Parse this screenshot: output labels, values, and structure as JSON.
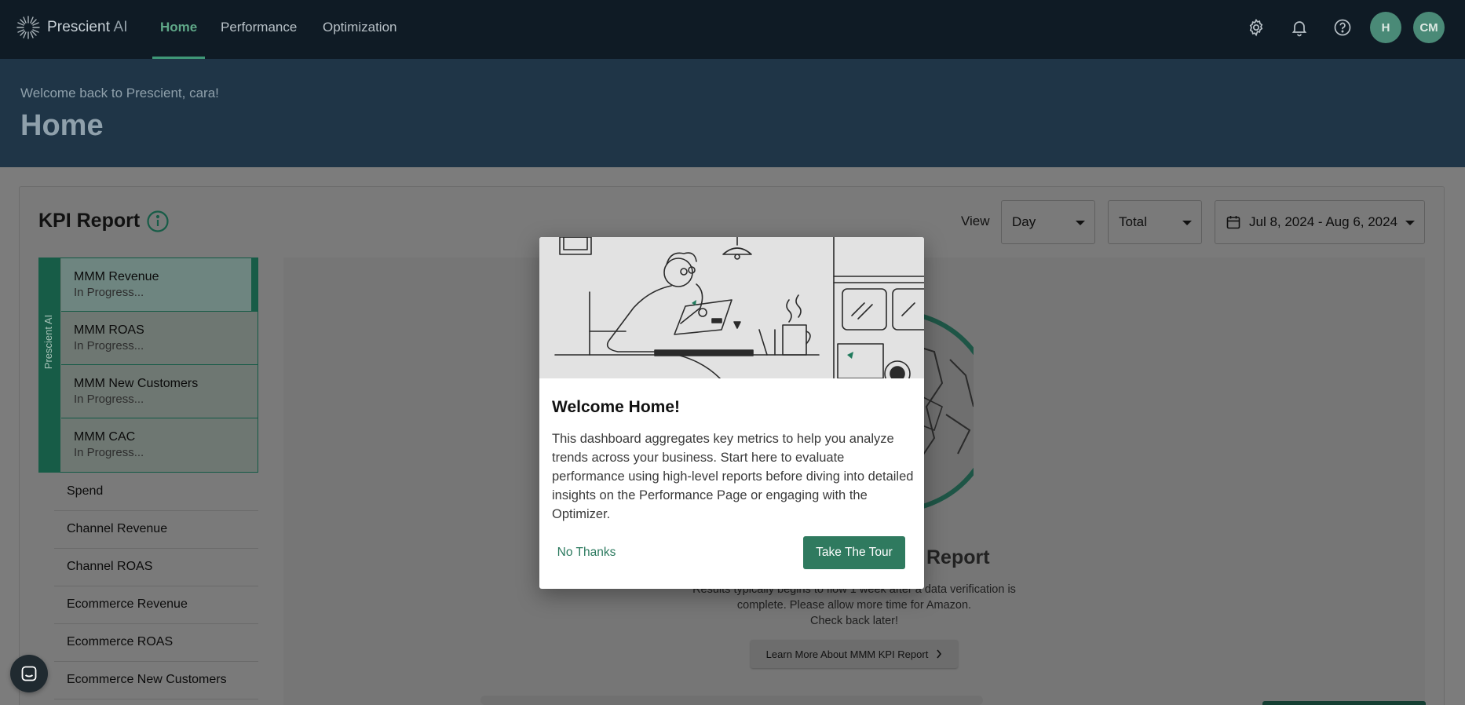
{
  "brand": {
    "name": "Prescient",
    "suffix": "AI"
  },
  "nav": {
    "tabs": [
      "Home",
      "Performance",
      "Optimization"
    ],
    "active": "Home"
  },
  "header_icons": [
    "gear-icon",
    "bell-icon",
    "help-icon"
  ],
  "avatars": [
    "H",
    "CM"
  ],
  "band": {
    "subtitle": "Welcome back to Prescient, cara!",
    "title": "Home"
  },
  "kpi": {
    "title": "KPI Report",
    "view_label": "View",
    "view_select": "Day",
    "agg_select": "Total",
    "date_range": "Jul 8, 2024 - Aug 6, 2024",
    "group_label": "Prescient AI",
    "highlighted": [
      {
        "label": "MMM Revenue",
        "status": "In Progress..."
      },
      {
        "label": "MMM ROAS",
        "status": "In Progress..."
      },
      {
        "label": "MMM New Customers",
        "status": "In Progress..."
      },
      {
        "label": "MMM CAC",
        "status": "In Progress..."
      }
    ],
    "items": [
      "Spend",
      "Channel Revenue",
      "Channel ROAS",
      "Ecommerce Revenue",
      "Ecommerce ROAS",
      "Ecommerce New Customers"
    ]
  },
  "empty_state": {
    "title_visible": "Report",
    "desc_line1": "Results typically begins to flow 1 week after a data verification is",
    "desc_line2": "complete. Please allow more time for Amazon.",
    "desc_line3": "Check back later!",
    "learn_more": "Learn More About MMM KPI Report"
  },
  "modal": {
    "title": "Welcome Home!",
    "body": "This dashboard aggregates key metrics to help you analyze trends across your business. Start here to evaluate performance using high-level reports before diving into detailed insights on the Performance Page or engaging with the Optimizer.",
    "secondary_label": "No Thanks",
    "primary_label": "Take The Tour"
  },
  "colors": {
    "accent": "#2f7a5f",
    "nav_bg": "#0f1b25",
    "band_bg": "#1f3547",
    "overlay": "#7a7a7a"
  }
}
